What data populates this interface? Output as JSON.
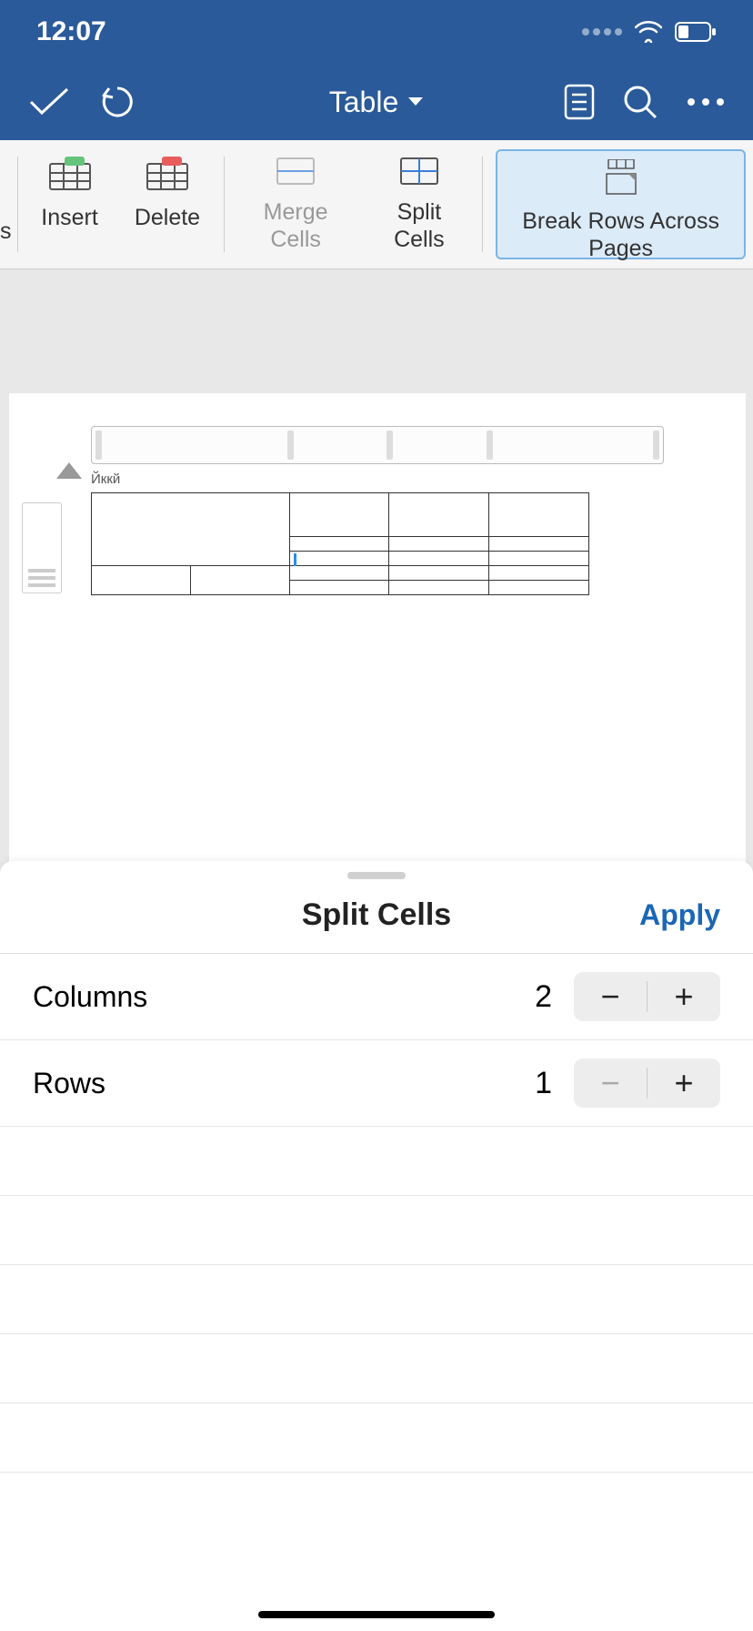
{
  "status": {
    "time": "12:07"
  },
  "nav": {
    "title": "Table"
  },
  "ribbon": {
    "partial": "s",
    "insert": "Insert",
    "delete": "Delete",
    "merge": "Merge Cells",
    "split": "Split Cells",
    "break": "Break Rows Across Pages"
  },
  "document": {
    "label": "Йккй"
  },
  "sheet": {
    "title": "Split Cells",
    "apply": "Apply",
    "columns_label": "Columns",
    "columns_value": "2",
    "rows_label": "Rows",
    "rows_value": "1"
  }
}
